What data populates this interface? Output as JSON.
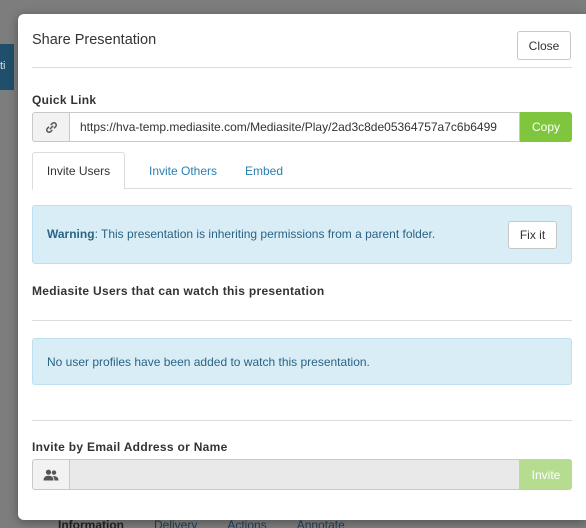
{
  "background": {
    "sidebar_text": "ti",
    "tabs": [
      "Information",
      "Delivery",
      "Actions",
      "Annotate"
    ]
  },
  "modal": {
    "title": "Share Presentation",
    "close_label": "Close"
  },
  "quick_link": {
    "label": "Quick Link",
    "url": "https://hva-temp.mediasite.com/Mediasite/Play/2ad3c8de05364757a7c6b6499",
    "link_icon": "link-icon",
    "copy_label": "Copy"
  },
  "tabs": {
    "invite_users": "Invite Users",
    "invite_others": "Invite Others",
    "embed": "Embed",
    "active": "invite_users"
  },
  "warning": {
    "prefix": "Warning",
    "message": ": This presentation is inheriting permissions from a parent folder.",
    "fix_label": "Fix it"
  },
  "users_section": {
    "heading": "Mediasite Users that can watch this presentation",
    "empty_message": "No user profiles have been added to watch this presentation."
  },
  "invite": {
    "heading": "Invite by Email Address or Name",
    "user_icon": "users-icon",
    "value": "",
    "invite_label": "Invite"
  },
  "colors": {
    "copy_green": "#7fc63e",
    "invite_green_disabled": "#b5dc8f",
    "info_bg": "#d9edf7",
    "link_blue": "#2a7fb0"
  }
}
